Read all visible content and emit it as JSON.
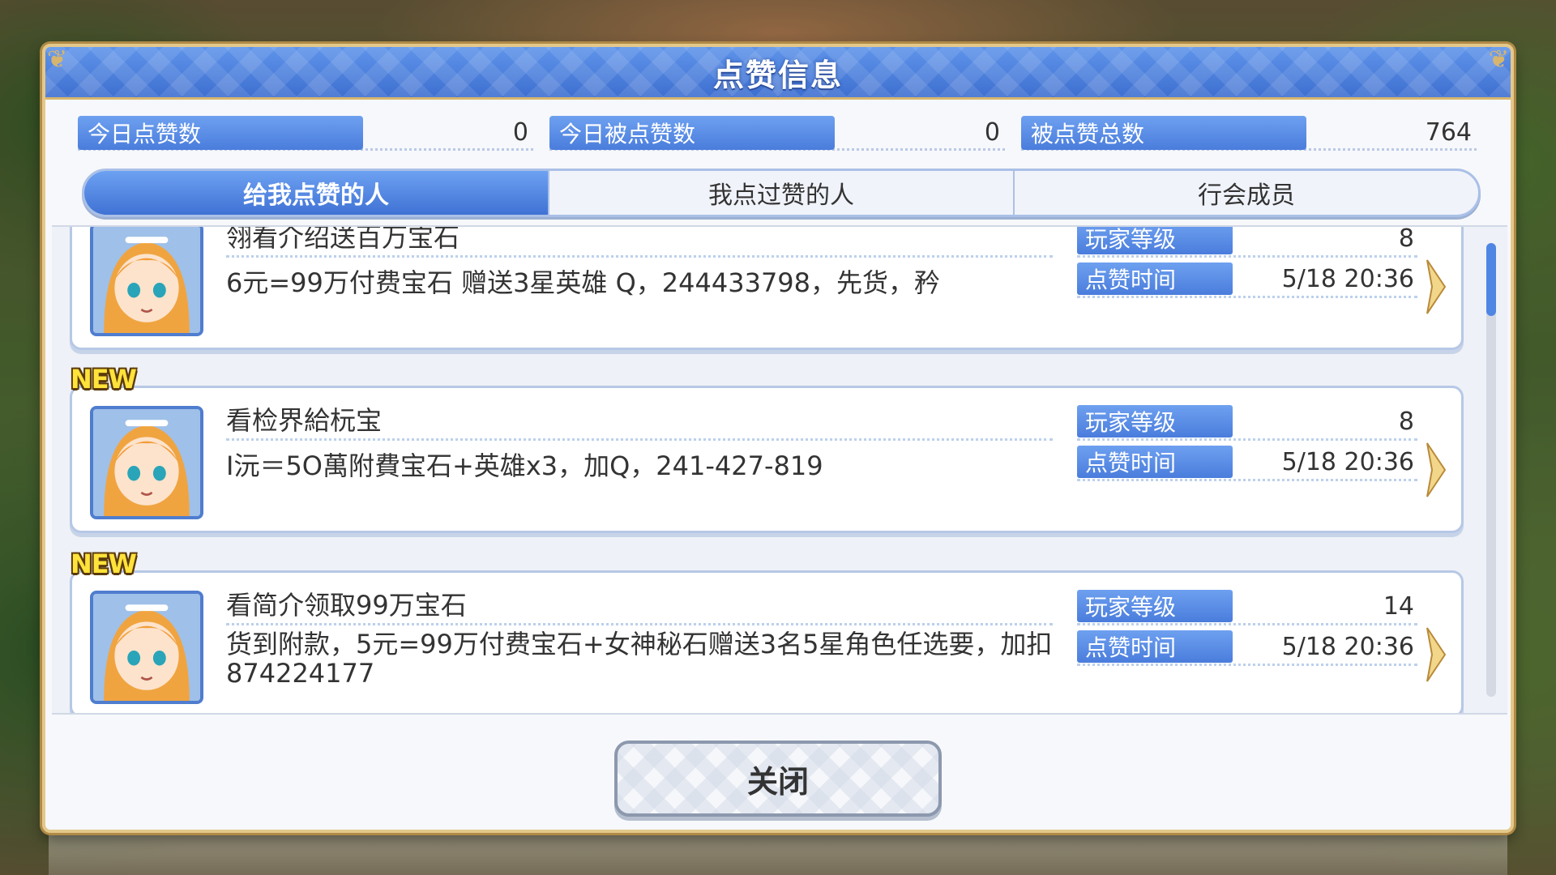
{
  "dialog": {
    "title": "点赞信息"
  },
  "stats": [
    {
      "label": "今日点赞数",
      "value": "0"
    },
    {
      "label": "今日被点赞数",
      "value": "0"
    },
    {
      "label": "被点赞总数",
      "value": "764"
    }
  ],
  "tabs": [
    {
      "label": "给我点赞的人",
      "active": true
    },
    {
      "label": "我点过赞的人",
      "active": false
    },
    {
      "label": "行会成员",
      "active": false
    }
  ],
  "labels": {
    "level": "玩家等级",
    "time": "点赞时间",
    "new_badge": "NEW"
  },
  "entries": [
    {
      "name": "翎看介绍送百万宝石",
      "message": "6元=99万付费宝石 赠送3星英雄 Q，244433798，先货，矜",
      "level": "8",
      "time": "5/18 20:36",
      "is_new": false
    },
    {
      "name": "看检界給杬宝",
      "message": "I沅＝5O萬附費宝石+英雄x3，加Q，241-427-819",
      "level": "8",
      "time": "5/18 20:36",
      "is_new": true
    },
    {
      "name": "看简介领取99万宝石",
      "message": "货到附款，5元=99万付费宝石+女神秘石赠送3名5星角色任选要，加扣874224177",
      "level": "14",
      "time": "5/18 20:36",
      "is_new": true
    }
  ],
  "close_button": {
    "label": "关闭"
  },
  "colors": {
    "header_blue": "#3e6fd0",
    "label_blue": "#4a7ddc",
    "gold": "#d7b56e",
    "new_yellow": "#ffe23a"
  }
}
